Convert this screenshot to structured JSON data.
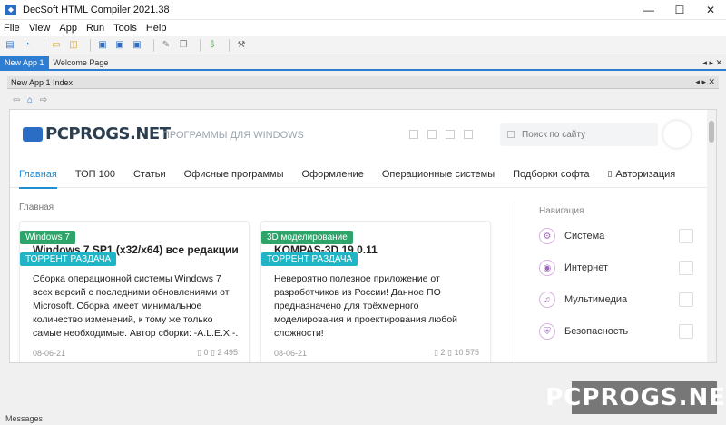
{
  "window": {
    "title": "DecSoft HTML Compiler 2021.38",
    "controls": [
      "—",
      "☐",
      "✕"
    ]
  },
  "menu": [
    "File",
    "View",
    "App",
    "Run",
    "Tools",
    "Help"
  ],
  "toolbar": {
    "icons": [
      "new-icon",
      "open-icon",
      "open-folder-icon",
      "explorer-icon",
      "save-icon",
      "save-as-icon",
      "save-all-icon",
      "edit-icon",
      "copy-icon",
      "download-icon",
      "settings-icon"
    ]
  },
  "tabs": {
    "documents": [
      "New App 1",
      "Welcome Page"
    ],
    "nav_arrows": "◂ ▸ ✕",
    "sub": [
      "New App 1 Index"
    ],
    "sub_nav": "◂ ▸ ✕"
  },
  "site": {
    "logo": "PCPROGS.NET",
    "tagline": "ПРОГРАММЫ ДЛЯ WINDOWS",
    "search_placeholder": "Поиск по сайту",
    "nav": [
      "Главная",
      "ТОП 100",
      "Статьи",
      "Офисные программы",
      "Оформление",
      "Операционные системы",
      "Подборки софта",
      "Авторизация"
    ],
    "breadcrumb": "Главная",
    "cards": [
      {
        "category": "Windows 7",
        "title": "Windows 7 SP1 (x32/x64) все редакции",
        "tag": "ТОРРЕНТ РАЗДАЧА",
        "description": "Сборка операционной системы Windows 7 всех версий с последними обновлениями от Microsoft. Сборка имеет минимальное количество изменений, к тому же только самые необходимые. Автор сборки: -A.L.E.X.-.",
        "date": "08-06-21",
        "meta": "▯ 0  ▯ 2 495"
      },
      {
        "category": "3D моделирование",
        "title": "KOMPAS-3D 19.0.11",
        "tag": "ТОРРЕНТ РАЗДАЧА",
        "description": "Невероятно полезное приложение от разработчиков из России! Данное ПО предназначено для трёхмерного моделирования и проектирования любой сложности!",
        "date": "08-06-21",
        "meta": "▯ 2  ▯ 10 575"
      }
    ],
    "sidebar": {
      "title": "Навигация",
      "items": [
        "Система",
        "Интернет",
        "Мультимедиа",
        "Безопасность"
      ]
    }
  },
  "status": {
    "messages": "Messages"
  },
  "watermark": "PCPROGS.NET",
  "colors": {
    "accent": "#2d7dd2",
    "link": "#1f8fd1",
    "green": "#2fa46a",
    "teal": "#1fb5c6"
  }
}
